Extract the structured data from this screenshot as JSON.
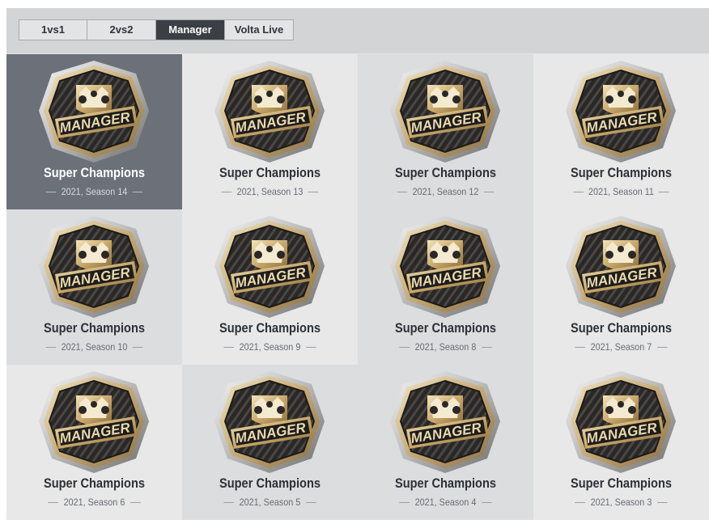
{
  "tabs": [
    {
      "label": "1vs1",
      "active": false
    },
    {
      "label": "2vs2",
      "active": false
    },
    {
      "label": "Manager",
      "active": true
    },
    {
      "label": "Volta Live",
      "active": false
    }
  ],
  "badge_text": "MANAGER",
  "selected_index": 0,
  "awards": [
    {
      "title": "Super Champions",
      "season": "2021, Season 14"
    },
    {
      "title": "Super Champions",
      "season": "2021, Season 13"
    },
    {
      "title": "Super Champions",
      "season": "2021, Season 12"
    },
    {
      "title": "Super Champions",
      "season": "2021, Season 11"
    },
    {
      "title": "Super Champions",
      "season": "2021, Season 10"
    },
    {
      "title": "Super Champions",
      "season": "2021, Season 9"
    },
    {
      "title": "Super Champions",
      "season": "2021, Season 8"
    },
    {
      "title": "Super Champions",
      "season": "2021, Season 7"
    },
    {
      "title": "Super Champions",
      "season": "2021, Season 6"
    },
    {
      "title": "Super Champions",
      "season": "2021, Season 5"
    },
    {
      "title": "Super Champions",
      "season": "2021, Season 4"
    },
    {
      "title": "Super Champions",
      "season": "2021, Season 3"
    }
  ],
  "colors": {
    "selected_card": "#6b7079",
    "active_tab": "#3b3f45",
    "badge_gold": "#c9a86a",
    "badge_dark": "#2a2826"
  }
}
